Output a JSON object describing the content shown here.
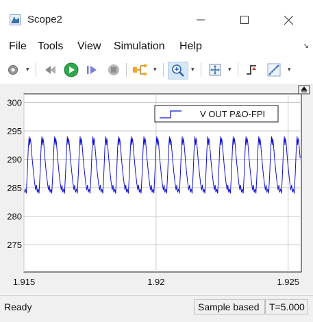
{
  "window": {
    "title": "Scope2"
  },
  "menu": {
    "items": [
      "File",
      "Tools",
      "View",
      "Simulation",
      "Help"
    ]
  },
  "chart_data": {
    "type": "line",
    "series": [
      {
        "name": "V OUT P&O-FPI",
        "color": "#1010d0"
      }
    ],
    "x_ticks": [
      "1.915",
      "1.92",
      "1.925"
    ],
    "y_ticks": [
      "300",
      "295",
      "290",
      "285",
      "280",
      "275"
    ],
    "xlim": [
      1.915,
      1.9255
    ],
    "ylim": [
      270.2,
      301.5
    ],
    "waveform": {
      "min": 284,
      "max": 294,
      "period": 0.000483,
      "cycles_shown": 21
    },
    "legend_position": "top-right",
    "grid": true
  },
  "status": {
    "left": "Ready",
    "mode": "Sample based",
    "time": "T=5.000"
  }
}
